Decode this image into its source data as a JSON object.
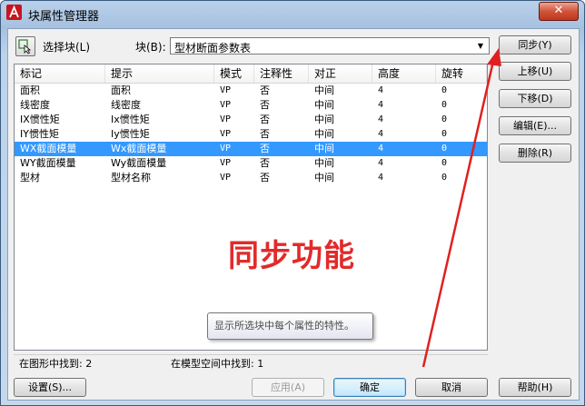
{
  "window": {
    "title": "块属性管理器",
    "close_glyph": "✕"
  },
  "toolbar": {
    "select_block_label": "选择块(L)",
    "block_label": "块(B):",
    "block_value": "型材断面参数表"
  },
  "table": {
    "columns": [
      "标记",
      "提示",
      "模式",
      "注释性",
      "对正",
      "高度",
      "旋转"
    ],
    "rows": [
      [
        "面积",
        "面积",
        "VP",
        "否",
        "中间",
        "4",
        "0"
      ],
      [
        "线密度",
        "线密度",
        "VP",
        "否",
        "中间",
        "4",
        "0"
      ],
      [
        "IX惯性矩",
        "Ix惯性矩",
        "VP",
        "否",
        "中间",
        "4",
        "0"
      ],
      [
        "IY惯性矩",
        "Iy惯性矩",
        "VP",
        "否",
        "中间",
        "4",
        "0"
      ],
      [
        "WX截面模量",
        "Wx截面模量",
        "VP",
        "否",
        "中间",
        "4",
        "0"
      ],
      [
        "WY截面模量",
        "Wy截面模量",
        "VP",
        "否",
        "中间",
        "4",
        "0"
      ],
      [
        "型材",
        "型材名称",
        "VP",
        "否",
        "中间",
        "4",
        "0"
      ]
    ],
    "selected_row": 4
  },
  "side_buttons": {
    "sync": "同步(Y)",
    "move_up": "上移(U)",
    "move_down": "下移(D)",
    "edit": "编辑(E)...",
    "delete": "删除(R)"
  },
  "overlay_text": "同步功能",
  "tooltip": "显示所选块中每个属性的特性。",
  "status": {
    "found_in_drawing": "在图形中找到: 2",
    "found_in_model": "在模型空间中找到: 1"
  },
  "bottom_buttons": {
    "settings": "设置(S)...",
    "apply": "应用(A)",
    "ok": "确定",
    "cancel": "取消",
    "help": "帮助(H)"
  },
  "colors": {
    "selection": "#3399ff",
    "overlay": "#e22a2a",
    "arrow": "#e02020"
  }
}
